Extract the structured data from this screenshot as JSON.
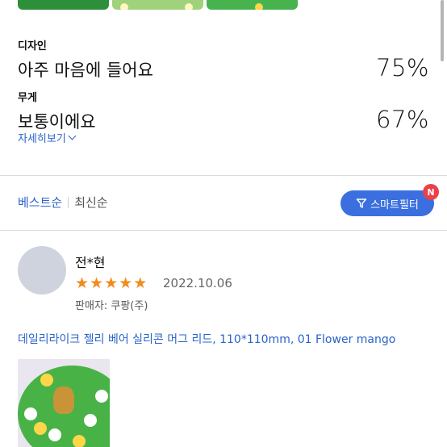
{
  "ratings": [
    {
      "label": "디자인",
      "text": "아주 마음에 들어요",
      "percent": "75%"
    },
    {
      "label": "무게",
      "text": "보통이에요",
      "percent": "67%"
    }
  ],
  "more_link": {
    "label": "자세히보기"
  },
  "sort": {
    "active": "베스트순",
    "inactive": "최신순"
  },
  "smart_filter": {
    "label": "스마트필터",
    "badge": "N"
  },
  "review": {
    "reviewer": "전*현",
    "stars": 5,
    "date": "2022.10.06",
    "seller": "판매자: 쿠팡(주)",
    "product": "데일리라이크 젤리 베어 실리콘 머그 리드, 110*110mm, 01 Flower mango"
  },
  "colors": {
    "accent": "#2a63c9",
    "filter_button": "#3b6fe0",
    "badge": "#e8414a",
    "star": "#f28b1d"
  },
  "icons": {
    "filter": "filter-funnel-icon",
    "chevron": "chevron-down-icon",
    "star": "star-icon"
  }
}
